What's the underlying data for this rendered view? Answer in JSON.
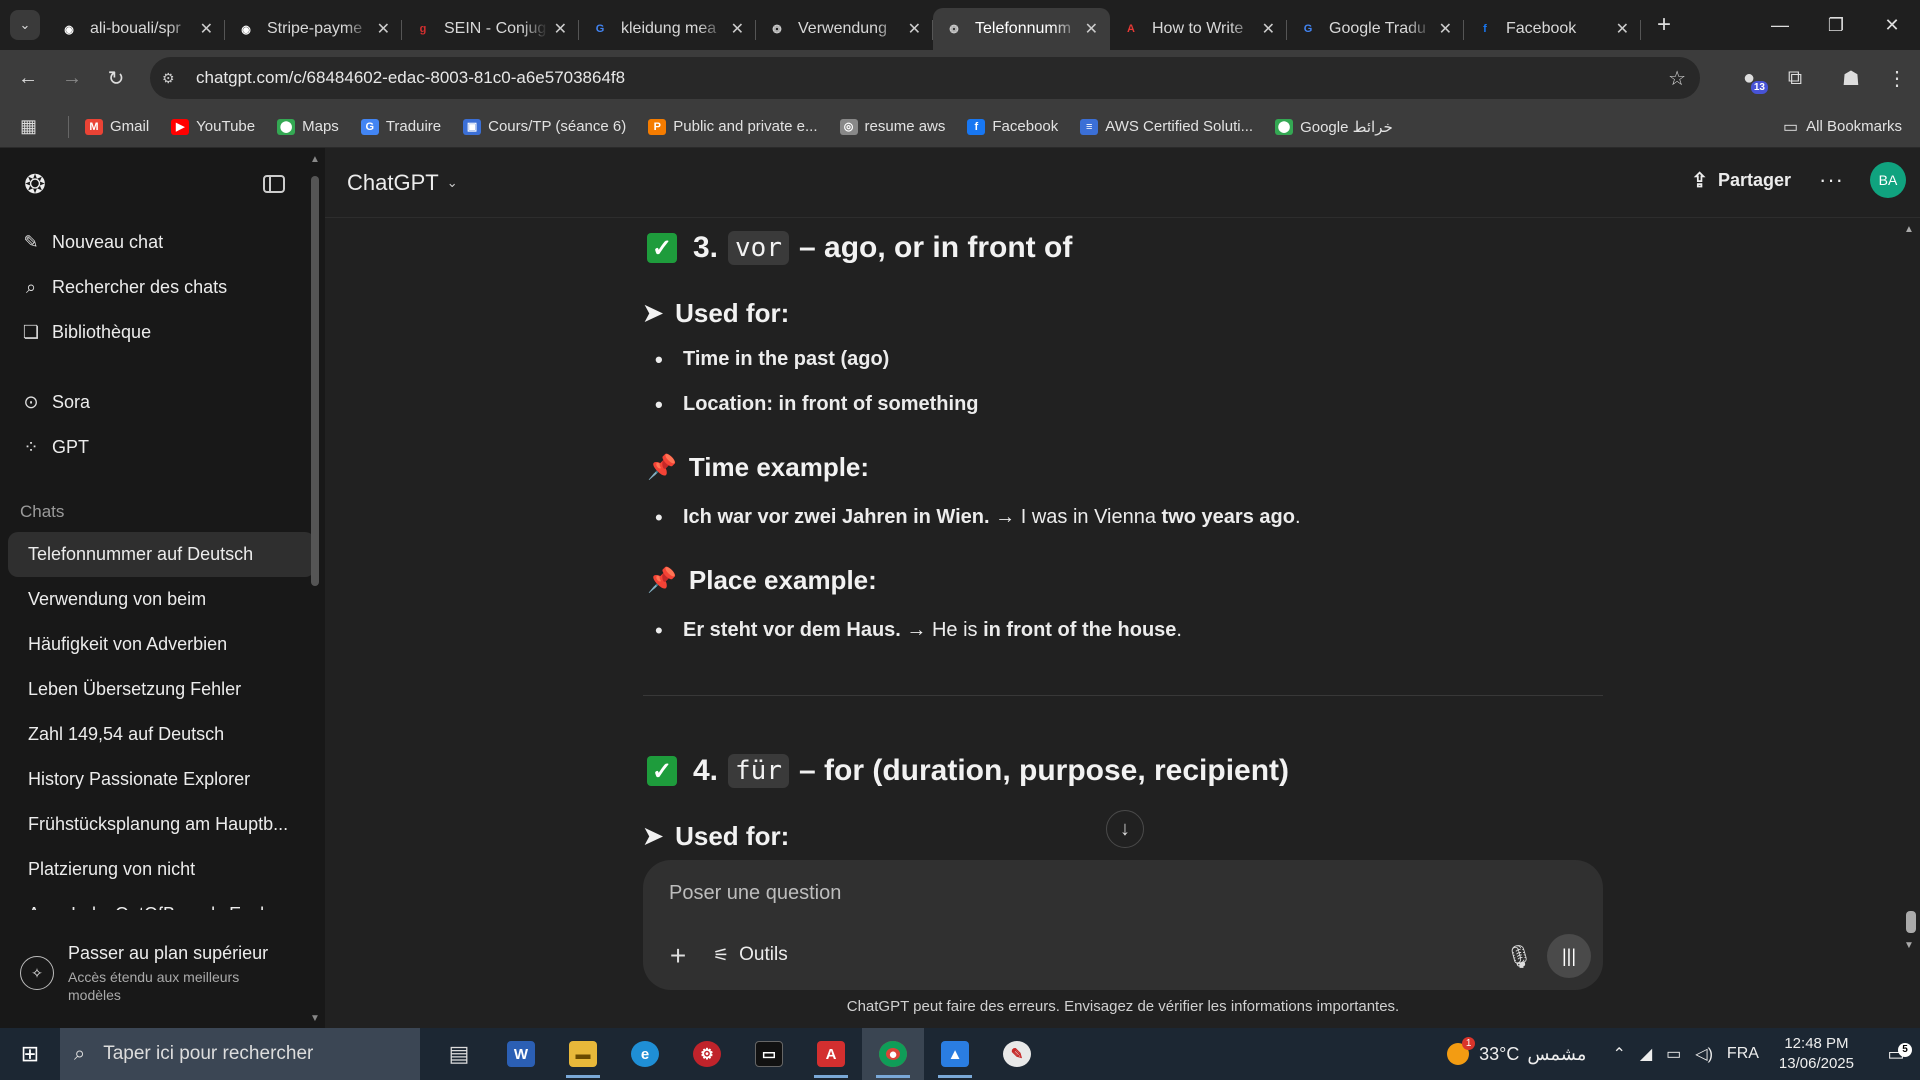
{
  "browser": {
    "tabs": [
      {
        "title": "ali-bouali/spr",
        "icon": "github-icon",
        "color": "#ffffff"
      },
      {
        "title": "Stripe-payme",
        "icon": "github-icon",
        "color": "#ffffff"
      },
      {
        "title": "SEIN - Conjug",
        "icon": "conjugation-icon",
        "color": "#d32f2f"
      },
      {
        "title": "kleidung mea",
        "icon": "google-icon",
        "color": "#4285f4"
      },
      {
        "title": "Verwendung",
        "icon": "chatgpt-icon",
        "color": "#cccccc"
      },
      {
        "title": "Telefonnumm",
        "icon": "chatgpt-icon",
        "color": "#cccccc",
        "active": true
      },
      {
        "title": "How to Write",
        "icon": "acrobat-icon",
        "color": "#e53935"
      },
      {
        "title": "Google Tradu",
        "icon": "google-translate-icon",
        "color": "#4285f4"
      },
      {
        "title": "Facebook",
        "icon": "facebook-icon",
        "color": "#1877f2"
      }
    ],
    "url": "chatgpt.com/c/68484602-edac-8003-81c0-a6e5703864f8",
    "extension_badge": "13",
    "bookmarks": [
      {
        "label": "Gmail",
        "color": "#ea4335",
        "glyph": "M"
      },
      {
        "label": "YouTube",
        "color": "#ff0000",
        "glyph": "▶"
      },
      {
        "label": "Maps",
        "color": "#34a853",
        "glyph": "⬤"
      },
      {
        "label": "Traduire",
        "color": "#4285f4",
        "glyph": "G"
      },
      {
        "label": "Cours/TP (séance 6)",
        "color": "#3b6fd6",
        "glyph": "▣"
      },
      {
        "label": "Public and private e...",
        "color": "#f57c00",
        "glyph": "P"
      },
      {
        "label": "resume aws",
        "color": "#888888",
        "glyph": "◎"
      },
      {
        "label": "Facebook",
        "color": "#1877f2",
        "glyph": "f"
      },
      {
        "label": "AWS Certified Soluti...",
        "color": "#3b6fd6",
        "glyph": "≡"
      },
      {
        "label": "Google خرائط",
        "color": "#34a853",
        "glyph": "⬤"
      }
    ],
    "all_bookmarks": "All Bookmarks"
  },
  "sidebar": {
    "nav": [
      {
        "label": "Nouveau chat",
        "icon": "edit-icon",
        "glyph": "✎"
      },
      {
        "label": "Rechercher des chats",
        "icon": "search-icon",
        "glyph": "⌕"
      },
      {
        "label": "Bibliothèque",
        "icon": "library-icon",
        "glyph": "❏"
      }
    ],
    "nav2": [
      {
        "label": "Sora",
        "icon": "play-circle-icon",
        "glyph": "⊙"
      },
      {
        "label": "GPT",
        "icon": "grid-icon",
        "glyph": "⁘"
      }
    ],
    "section_title": "Chats",
    "chats": [
      "Telefonnummer auf Deutsch",
      "Verwendung von beim",
      "Häufigkeit von Adverbien",
      "Leben Übersetzung Fehler",
      "Zahl 149,54 auf Deutsch",
      "History Passionate Explorer",
      "Frühstücksplanung am Hauptb...",
      "Platzierung von nicht",
      "ArrayIndexOutOfBounds Expla..."
    ],
    "upgrade_title": "Passer au plan supérieur",
    "upgrade_sub": "Accès étendu aux meilleurs modèles"
  },
  "header": {
    "model": "ChatGPT",
    "share": "Partager",
    "avatar": "BA"
  },
  "content": {
    "s3": {
      "num": "3.",
      "code": "vor",
      "rest": "– ago, or in front of"
    },
    "used_for": "Used for:",
    "used_for_items": [
      "Time in the past (ago)",
      "Location: in front of something"
    ],
    "time_example_title": "Time example:",
    "time_example": {
      "de": "Ich war vor zwei Jahren in Wien.",
      "arrow": " → ",
      "en_pre": "I was in Vienna ",
      "en_bold": "two years ago",
      "en_post": "."
    },
    "place_example_title": "Place example:",
    "place_example": {
      "de": "Er steht vor dem Haus.",
      "arrow": " → ",
      "en_pre": "He is ",
      "en_bold": "in front of the house",
      "en_post": "."
    },
    "s4": {
      "num": "4.",
      "code": "für",
      "rest": "– for (duration, purpose, recipient)"
    },
    "cut_text": "Used for:"
  },
  "composer": {
    "placeholder": "Poser une question",
    "tools": "Outils"
  },
  "disclaimer": "ChatGPT peut faire des erreurs. Envisagez de vérifier les informations importantes.",
  "taskbar": {
    "search": "Taper ici pour rechercher",
    "weather_temp": "33°C",
    "weather_text": "مشمس",
    "weather_badge": "1",
    "lang": "FRA",
    "time": "12:48 PM",
    "date": "13/06/2025",
    "notifications": "5"
  }
}
